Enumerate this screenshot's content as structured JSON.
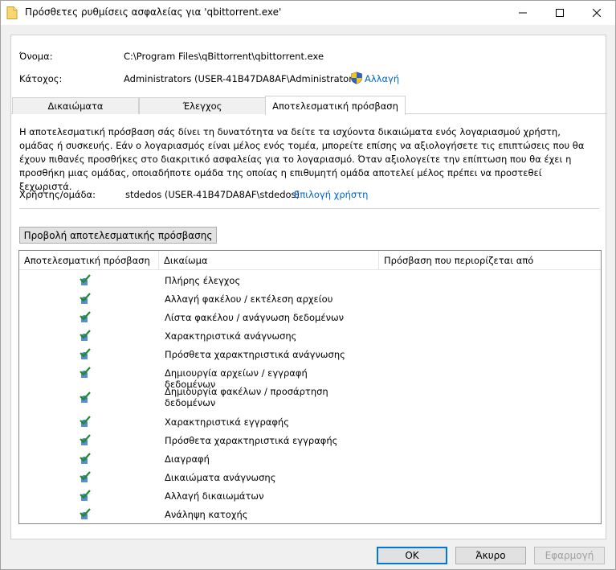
{
  "window": {
    "title": "Πρόσθετες ρυθμίσεις ασφαλείας για 'qbittorrent.exe'"
  },
  "info": {
    "name_label": "Όνομα:",
    "name_value": "C:\\Program Files\\qBittorrent\\qbittorrent.exe",
    "owner_label": "Κάτοχος:",
    "owner_value": "Administrators (USER-41B47DA8AF\\Administrators)",
    "change_link": "Αλλαγή"
  },
  "tabs": [
    {
      "label": "Δικαιώματα",
      "active": false
    },
    {
      "label": "Έλεγχος",
      "active": false
    },
    {
      "label": "Αποτελεσματική πρόσβαση",
      "active": true
    }
  ],
  "description": "Η αποτελεσματική πρόσβαση σάς δίνει τη δυνατότητα να δείτε τα ισχύοντα δικαιώματα ενός λογαριασμού χρήστη, ομάδας ή συσκευής. Εάν ο λογαριασμός είναι μέλος ενός τομέα, μπορείτε επίσης να αξιολογήσετε τις επιπτώσεις που θα έχουν πιθανές προσθήκες στο διακριτικό ασφαλείας για το λογαριασμό. Όταν αξιολογείτε την επίπτωση που θα έχει η προσθήκη μιας ομάδας, οποιαδήποτε ομάδα της οποίας η επιθυμητή ομάδα αποτελεί μέλος πρέπει να προστεθεί ξεχωριστά.",
  "user": {
    "label": "Χρήστης/ομάδα:",
    "value": "stdedos (USER-41B47DA8AF\\stdedos)",
    "select_link": "Επιλογή χρήστη"
  },
  "view_button": "Προβολή αποτελεσματικής πρόσβασης",
  "table": {
    "headers": {
      "effective": "Αποτελεσματική πρόσβαση",
      "permission": "Δικαίωμα",
      "limited_by": "Πρόσβαση που περιορίζεται από"
    },
    "rows": [
      {
        "permission": "Πλήρης έλεγχος"
      },
      {
        "permission": "Αλλαγή φακέλου / εκτέλεση αρχείου"
      },
      {
        "permission": "Λίστα φακέλου / ανάγνωση δεδομένων"
      },
      {
        "permission": "Χαρακτηριστικά ανάγνωσης"
      },
      {
        "permission": "Πρόσθετα χαρακτηριστικά ανάγνωσης"
      },
      {
        "permission": "Δημιουργία αρχείων / εγγραφή δεδομένων"
      },
      {
        "permission": "Δημιουργία φακέλων / προσάρτηση δεδομένων"
      },
      {
        "permission": "Χαρακτηριστικά εγγραφής"
      },
      {
        "permission": "Πρόσθετα χαρακτηριστικά εγγραφής"
      },
      {
        "permission": "Διαγραφή"
      },
      {
        "permission": "Δικαιώματα ανάγνωσης"
      },
      {
        "permission": "Αλλαγή δικαιωμάτων"
      },
      {
        "permission": "Ανάληψη κατοχής"
      }
    ]
  },
  "buttons": {
    "ok": "OK",
    "cancel": "Άκυρο",
    "apply": "Εφαρμογή"
  }
}
